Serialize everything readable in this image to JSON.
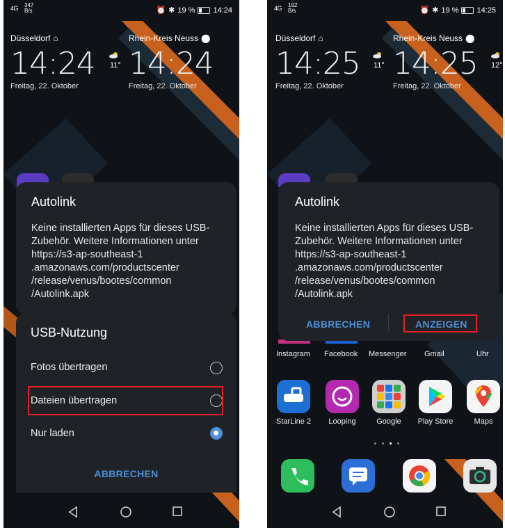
{
  "left": {
    "status": {
      "signal": "4G",
      "rate_value": "347",
      "rate_unit": "B/s",
      "right": "19 %",
      "time": "14:24"
    },
    "clock1": {
      "city": "Düsseldorf",
      "time": "14:24",
      "date": "Freitag, 22. Oktober",
      "temp": "11°"
    },
    "clock2": {
      "city": "Rhein-Kreis Neuss",
      "time": "14:24",
      "date": "Freitag, 22. Oktober"
    },
    "autolink_dialog": {
      "title": "Autolink",
      "body": "Keine installierten Apps für dieses USB-Zubehör. Weitere Informationen unter https://s3-ap-southeast-1 .amazonaws.com/productscenter /release/venus/bootes/common /Autolink.apk"
    },
    "usb_dialog": {
      "title": "USB-Nutzung",
      "options": [
        {
          "label": "Fotos übertragen",
          "selected": false
        },
        {
          "label": "Dateien übertragen",
          "selected": false
        },
        {
          "label": "Nur laden",
          "selected": true
        }
      ],
      "cancel_label": "ABBRECHEN"
    }
  },
  "right": {
    "status": {
      "signal": "4G",
      "rate_value": "192",
      "rate_unit": "B/s",
      "right": "19 %",
      "time": "14:25"
    },
    "clock1": {
      "city": "Düsseldorf",
      "time": "14:25",
      "date": "Freitag, 22. Oktober",
      "temp": "11°"
    },
    "clock2": {
      "city": "Rhein-Kreis Neuss",
      "time": "14:25",
      "date": "Freitag, 22. Oktober",
      "temp": "12°"
    },
    "autolink_dialog": {
      "title": "Autolink",
      "body": "Keine installierten Apps für dieses USB-Zubehör. Weitere Informationen unter https://s3-ap-southeast-1 .amazonaws.com/productscenter /release/venus/bootes/common /Autolink.apk",
      "cancel_label": "ABBRECHEN",
      "show_label": "ANZEIGEN"
    },
    "apps_row1": [
      "Instagram",
      "Facebook",
      "Messenger",
      "Gmail",
      "Uhr"
    ],
    "apps_row2": [
      "StarLine 2",
      "Looping",
      "Google",
      "Play Store",
      "Maps"
    ]
  },
  "colors": {
    "accent": "#4f8fd9",
    "highlight": "#e32027",
    "dialog_bg": "#1f2327",
    "wallpaper_stripe": "#c8611e"
  }
}
